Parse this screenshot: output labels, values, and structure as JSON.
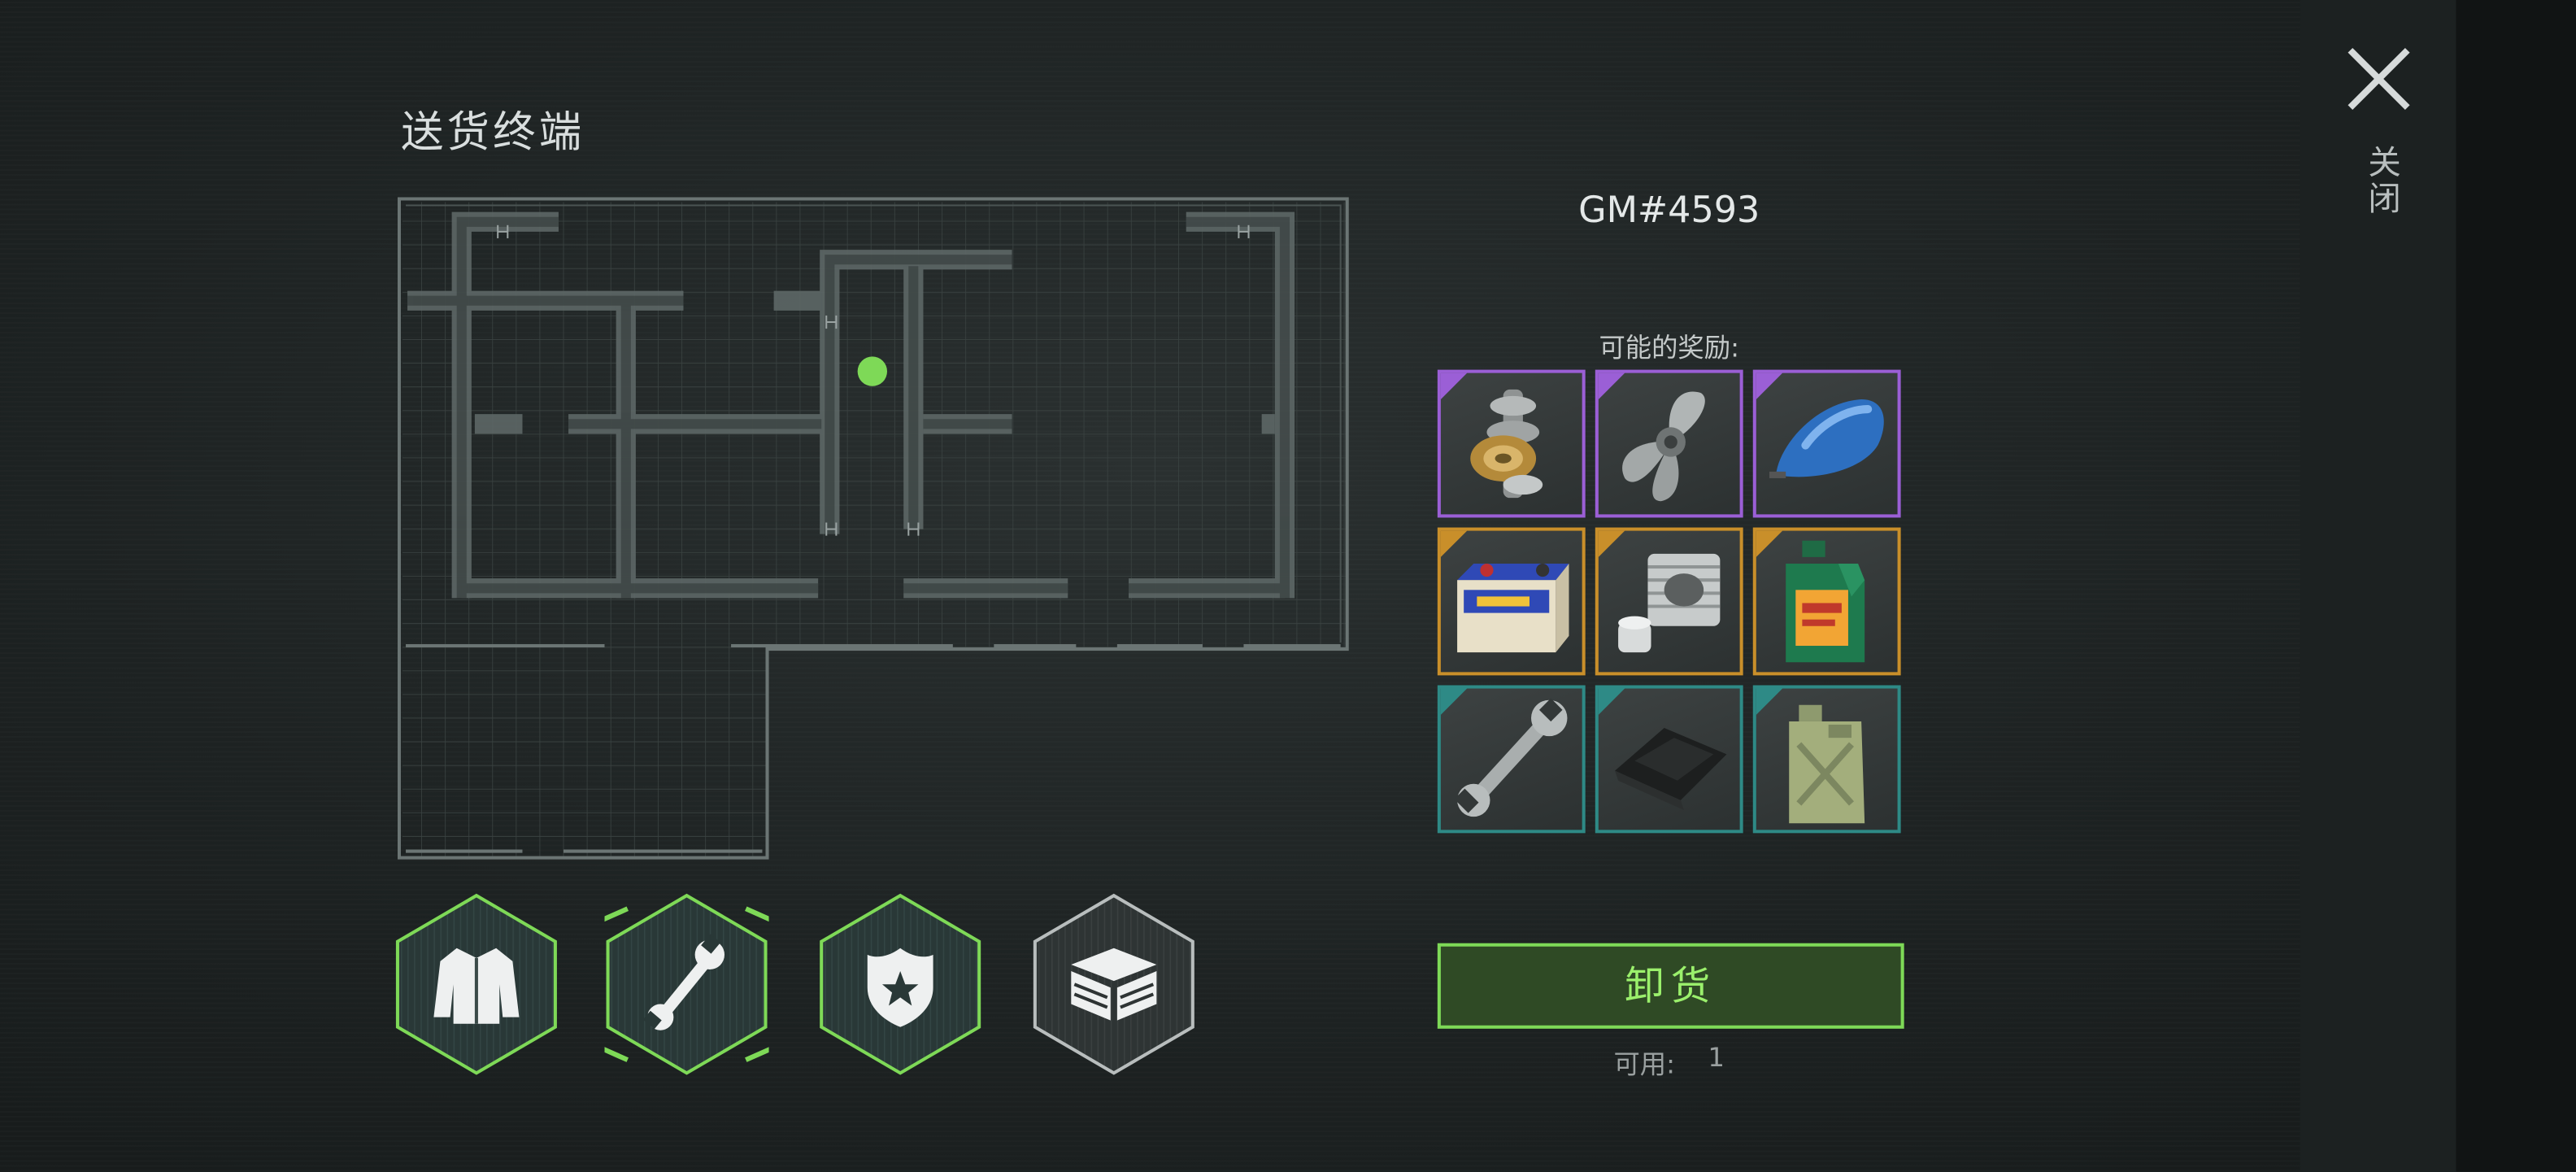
{
  "window": {
    "title": "送货终端",
    "close_label": "关闭"
  },
  "delivery": {
    "code": "GM#4593",
    "rewards_label": "可能的奖励:",
    "unload_label": "卸货",
    "available_label": "可用:",
    "available_count": "1"
  },
  "rewards": [
    {
      "item": "camshaft-icon",
      "rarity": "epic"
    },
    {
      "item": "propeller-icon",
      "rarity": "epic"
    },
    {
      "item": "fuel-tank-icon",
      "rarity": "epic"
    },
    {
      "item": "car-battery-icon",
      "rarity": "rare"
    },
    {
      "item": "engine-cylinder-icon",
      "rarity": "rare"
    },
    {
      "item": "motor-oil-icon",
      "rarity": "rare"
    },
    {
      "item": "wrench-icon",
      "rarity": "common"
    },
    {
      "item": "rubber-sheet-icon",
      "rarity": "common"
    },
    {
      "item": "jerrycan-icon",
      "rarity": "common"
    }
  ],
  "rarity_colors": {
    "epic": "#9b5fd6",
    "rare": "#c98f2a",
    "common": "#2e8a86"
  },
  "categories": [
    {
      "icon": "jacket-icon",
      "selected": false
    },
    {
      "icon": "wrench-icon",
      "selected": true
    },
    {
      "icon": "police-badge-icon",
      "selected": false
    },
    {
      "icon": "crate-icon",
      "selected": false
    }
  ],
  "colors": {
    "accent_green": "#7ed957",
    "map_line": "#5f6a69",
    "player_dot": "#7ed957"
  }
}
